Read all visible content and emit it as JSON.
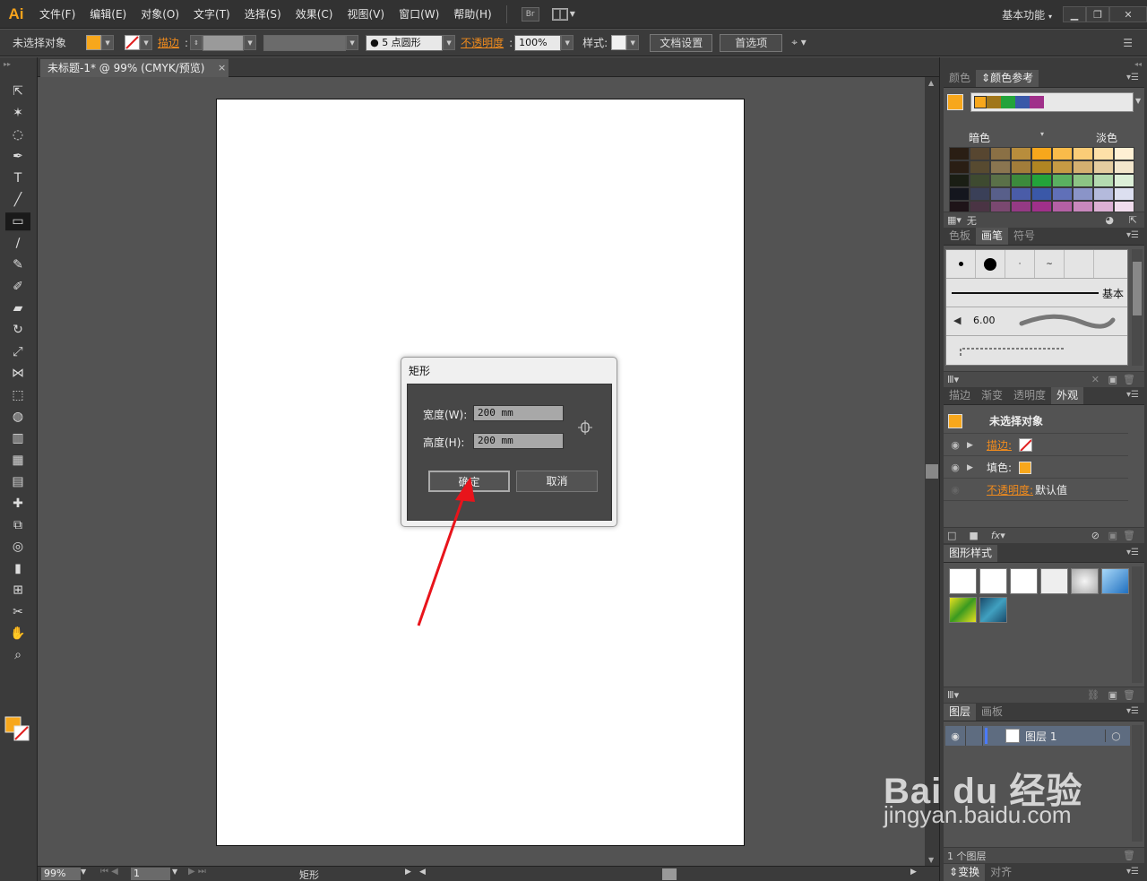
{
  "app": {
    "logo": "Ai"
  },
  "menu": {
    "items": [
      "文件(F)",
      "编辑(E)",
      "对象(O)",
      "文字(T)",
      "选择(S)",
      "效果(C)",
      "视图(V)",
      "窗口(W)",
      "帮助(H)"
    ],
    "bridge": "Br"
  },
  "workspace": {
    "label": "基本功能"
  },
  "control_bar": {
    "selection_label": "未选择对象",
    "stroke_label": "描边",
    "brush": "5 点圆形",
    "opacity_label": "不透明度",
    "opacity_value": "100%",
    "style_label": "样式",
    "doc_setup": "文档设置",
    "preferences": "首选项"
  },
  "colors": {
    "fill": "#f7a71c",
    "accent_orange": "#f08b1d"
  },
  "document": {
    "tab_title": "未标题-1* @ 99% (CMYK/预览)",
    "close": "×"
  },
  "dialog": {
    "title": "矩形",
    "width_label": "宽度(W):",
    "width_value": "200 mm",
    "height_label": "高度(H):",
    "height_value": "200 mm",
    "ok": "确定",
    "cancel": "取消"
  },
  "status": {
    "zoom": "99%",
    "page": "1",
    "tool": "矩形"
  },
  "panels": {
    "color": {
      "tabs": [
        "颜色",
        "颜色参考"
      ],
      "dark": "暗色",
      "light": "淡色",
      "none": "无"
    },
    "brushes": {
      "tabs": [
        "色板",
        "画笔",
        "符号"
      ],
      "basic": "基本",
      "size": "6.00"
    },
    "appearance": {
      "tabs": [
        "描边",
        "渐变",
        "透明度",
        "外观"
      ],
      "header": "未选择对象",
      "stroke": "描边:",
      "fill": "填色:",
      "opacity": "不透明度:",
      "opacity_value": "默认值"
    },
    "graphic_styles": {
      "tabs": [
        "图形样式"
      ]
    },
    "layers": {
      "tabs": [
        "图层",
        "画板"
      ],
      "layer1": "图层 1",
      "count": "1 个图层"
    },
    "bottom": {
      "tabs": [
        "变换",
        "对齐"
      ]
    }
  },
  "watermark": {
    "brand": "Bai du 经验",
    "url": "jingyan.baidu.com"
  }
}
